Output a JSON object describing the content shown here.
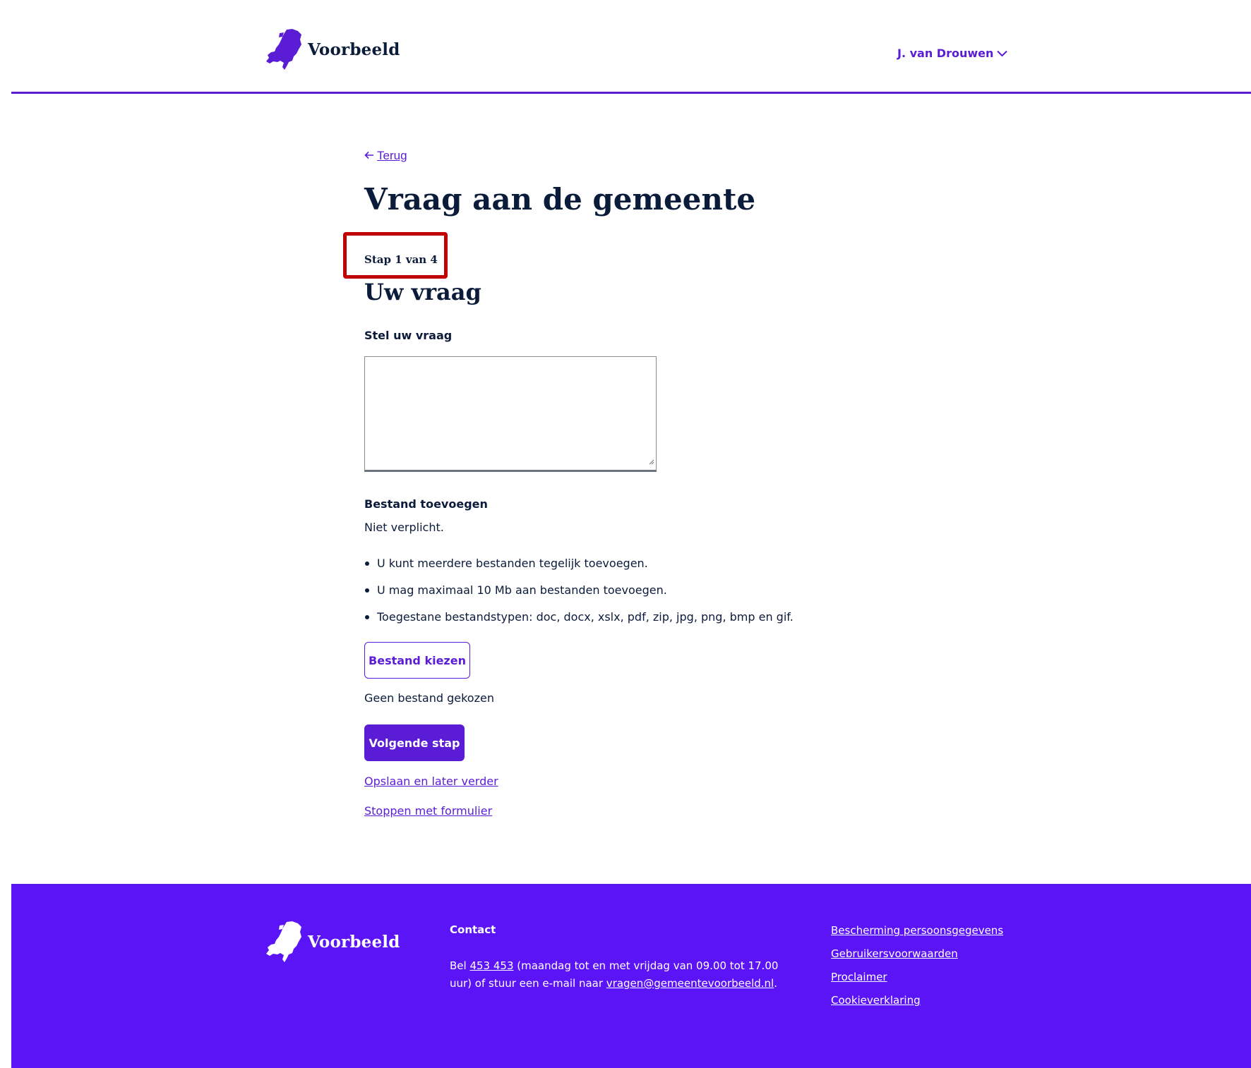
{
  "header": {
    "logo_text": "Voorbeeld",
    "user_name": "J. van Drouwen"
  },
  "main": {
    "back_label": "Terug",
    "page_title": "Vraag aan de gemeente",
    "step_label": "Stap 1 van 4",
    "section_title": "Uw vraag",
    "question_label": "Stel uw vraag",
    "question_value": "",
    "upload_title": "Bestand toevoegen",
    "upload_hint": "Niet verplicht.",
    "upload_rules": [
      "U kunt meerdere bestanden tegelijk toevoegen.",
      "U mag maximaal 10 Mb aan bestanden toevoegen.",
      "Toegestane bestandstypen: doc, docx, xslx, pdf, zip, jpg, png, bmp en gif."
    ],
    "choose_file_label": "Bestand kiezen",
    "no_file_text": "Geen bestand gekozen",
    "next_label": "Volgende stap",
    "save_later_label": "Opslaan en later verder",
    "stop_label": "Stoppen met formulier"
  },
  "footer": {
    "logo_text": "Voorbeeld",
    "contact_title": "Contact",
    "contact_prefix": "Bel ",
    "phone": "453 453",
    "contact_middle": " (maandag tot en met vrijdag van 09.00 tot 17.00 uur) of stuur een e-mail naar ",
    "email": "vragen@gemeentevoorbeeld.nl",
    "contact_suffix": ".",
    "links": [
      "Bescherming persoonsgegevens",
      "Gebruikersvoorwaarden",
      "Proclaimer",
      "Cookieverklaring"
    ]
  },
  "colors": {
    "brand": "#5b1cd6",
    "footer_bg": "#5b14f5",
    "text": "#0b1b3a",
    "highlight": "#c00000"
  },
  "icons": {
    "logo": "netherlands-map-icon",
    "user_menu": "chevron-down-icon",
    "back": "arrow-left-icon",
    "textarea": "resize-handle-icon"
  }
}
